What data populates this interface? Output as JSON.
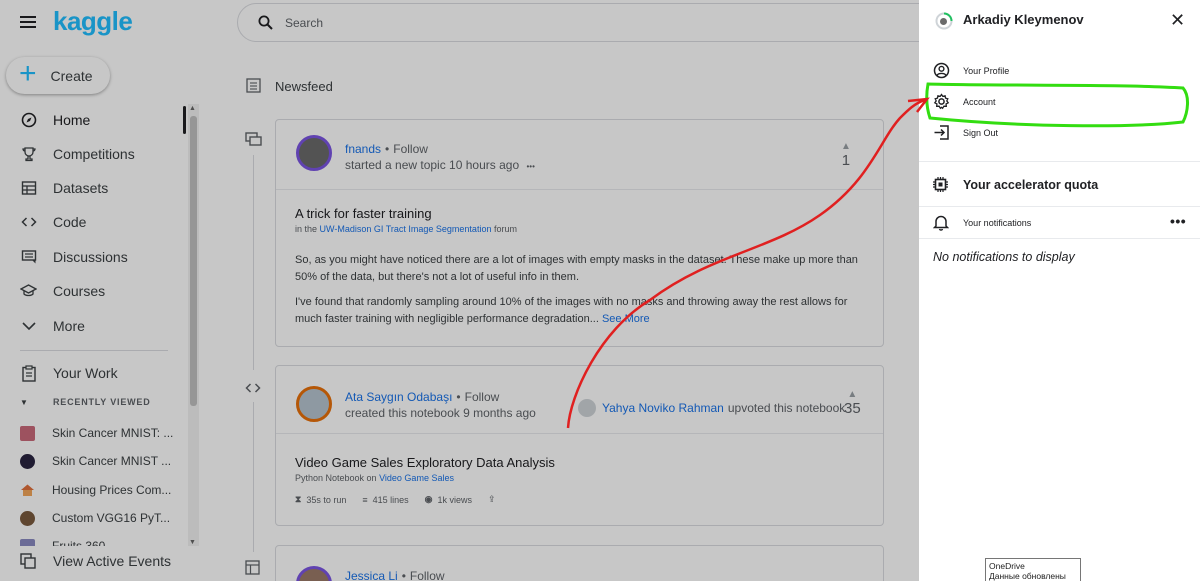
{
  "sidebar": {
    "logo": "kaggle",
    "create_label": "Create",
    "items": [
      {
        "label": "Home",
        "icon": "compass-icon"
      },
      {
        "label": "Competitions",
        "icon": "trophy-icon"
      },
      {
        "label": "Datasets",
        "icon": "table-icon"
      },
      {
        "label": "Code",
        "icon": "code-icon"
      },
      {
        "label": "Discussions",
        "icon": "discussion-icon"
      },
      {
        "label": "Courses",
        "icon": "school-icon"
      },
      {
        "label": "More",
        "icon": "chevron-down-icon"
      }
    ],
    "your_work": "Your Work",
    "recently_viewed_header": "RECENTLY VIEWED",
    "recent": [
      {
        "label": "Skin Cancer MNIST: ...",
        "color": "#c96a7a"
      },
      {
        "label": "Skin Cancer MNIST ...",
        "color": "#2a2440"
      },
      {
        "label": "Housing Prices Com...",
        "color": "#e0703c"
      },
      {
        "label": "Custom VGG16 PyT...",
        "color": "#7a5a3e"
      },
      {
        "label": "Fruits 360",
        "color": "#8a8ac0"
      }
    ],
    "active_events": "View Active Events"
  },
  "main": {
    "search_placeholder": "Search",
    "newsfeed_title": "Newsfeed",
    "posts": [
      {
        "author": "fnands",
        "follow": "Follow",
        "subline": "started a new topic 10 hours ago",
        "more": "•••",
        "votes": "1",
        "title": "A trick for faster training",
        "context_prefix": "in the",
        "context_link": "UW-Madison GI Tract Image Segmentation",
        "context_suffix": "forum",
        "para1": "So, as you might have noticed there are a lot of images with empty masks in the dataset. These make up more than 50% of the data, but there's not a lot of useful info in them.",
        "para2": "I've found that randomly sampling around 10% of the images with no masks and throwing away the rest allows for much faster training with negligible performance degradation...",
        "see_more": "See More"
      },
      {
        "author": "Ata Saygın Odabaşı",
        "follow": "Follow",
        "subline": "created this notebook 9 months ago",
        "upvoter": "Yahya Noviko Rahman",
        "upvote_text": "upvoted this notebook",
        "votes": "35",
        "title": "Video Game Sales Exploratory Data Analysis",
        "context_prefix": "Python Notebook on",
        "context_link": "Video Game Sales",
        "run_time": "35s to run",
        "lines": "415 lines",
        "views": "1k views"
      },
      {
        "author": "Jessica Li",
        "follow": "Follow"
      }
    ]
  },
  "panel": {
    "user_name": "Arkadiy Kleymenov",
    "close": "✕",
    "menu": [
      {
        "label": "Your Profile",
        "icon": "user-circle-icon"
      },
      {
        "label": "Account",
        "icon": "gear-icon"
      },
      {
        "label": "Sign Out",
        "icon": "sign-out-icon"
      }
    ],
    "quota": "Your accelerator quota",
    "notifications": "Your notifications",
    "notif_more": "•••",
    "no_notifications": "No notifications to display"
  },
  "tooltip": {
    "line1": "OneDrive",
    "line2": "Данные обновлены"
  },
  "colors": {
    "brand": "#20beff",
    "link": "#1a73e8",
    "annotation_green": "#33dd11",
    "annotation_red": "#e02020"
  }
}
